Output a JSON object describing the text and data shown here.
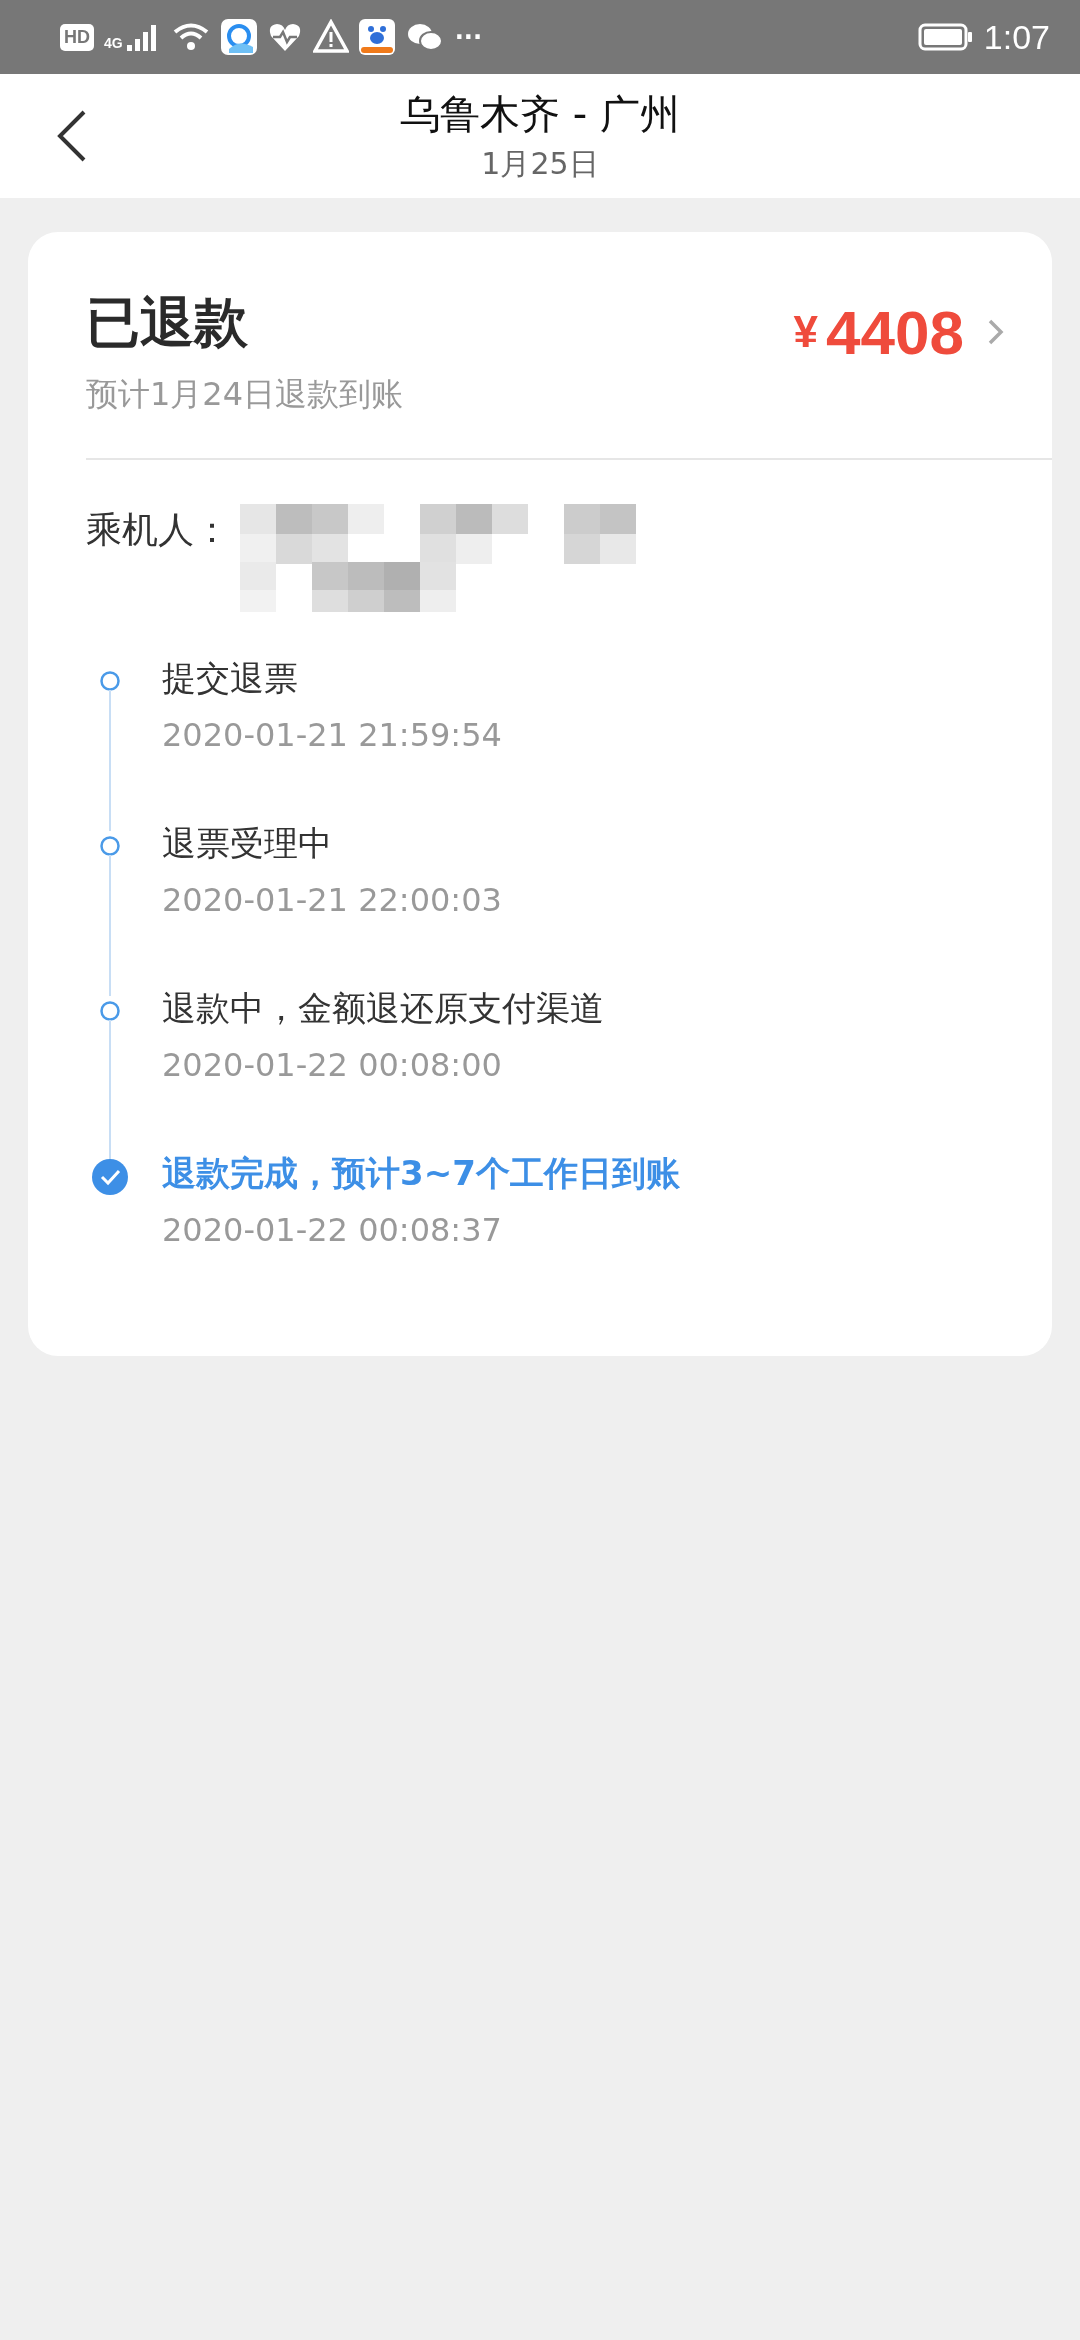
{
  "status_bar": {
    "hd_badge": "HD",
    "network": "4G",
    "more": "···",
    "time": "1:07"
  },
  "header": {
    "title": "乌鲁木齐 - 广州",
    "subtitle": "1月25日"
  },
  "refund": {
    "status": "已退款",
    "note": "预计1月24日退款到账",
    "currency": "¥",
    "amount": "4408"
  },
  "passenger": {
    "label": "乘机人："
  },
  "timeline": [
    {
      "title": "提交退票",
      "time": "2020-01-21 21:59:54",
      "current": false
    },
    {
      "title": "退票受理中",
      "time": "2020-01-21 22:00:03",
      "current": false
    },
    {
      "title": "退款中，金额退还原支付渠道",
      "time": "2020-01-22 00:08:00",
      "current": false
    },
    {
      "title": "退款完成，预计3~7个工作日到账",
      "time": "2020-01-22 00:08:37",
      "current": true
    }
  ]
}
